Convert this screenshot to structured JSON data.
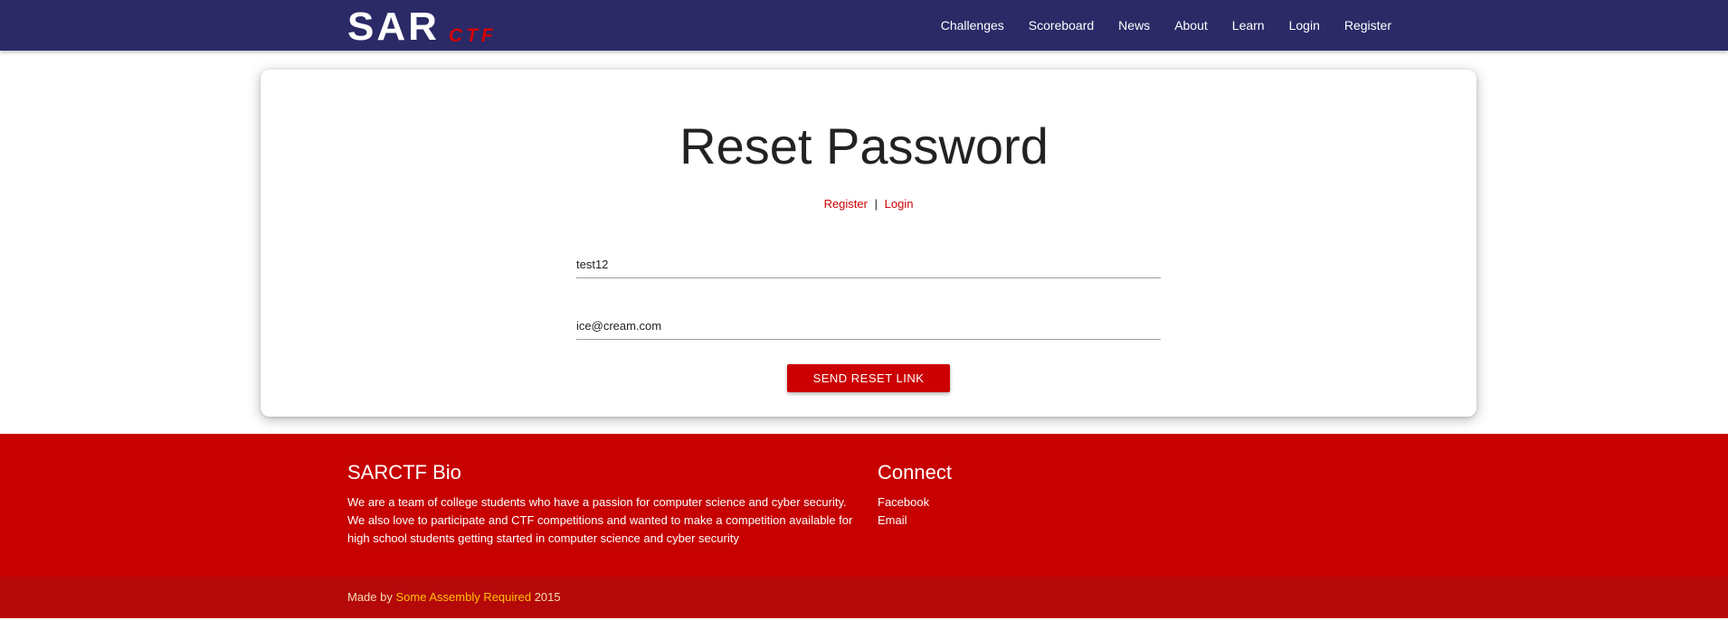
{
  "brand": {
    "logo_main": "SAR",
    "logo_sub": "CTF"
  },
  "nav": {
    "items": [
      {
        "label": "Challenges"
      },
      {
        "label": "Scoreboard"
      },
      {
        "label": "News"
      },
      {
        "label": "About"
      },
      {
        "label": "Learn"
      },
      {
        "label": "Login"
      },
      {
        "label": "Register"
      }
    ]
  },
  "form": {
    "title": "Reset Password",
    "register_link": "Register",
    "separator": "|",
    "login_link": "Login",
    "username_value": "test12",
    "email_value": "ice@cream.com",
    "submit_label": "SEND RESET LINK"
  },
  "footer": {
    "bio_title": "SARCTF Bio",
    "bio_text": "We are a team of college students who have a passion for computer science and cyber security. We also love to participate and CTF competitions and wanted to make a competition available for high school students getting started in computer science and cyber security",
    "connect_title": "Connect",
    "connect_links": [
      "Facebook",
      "Email"
    ],
    "made_by_prefix": "Made by",
    "made_by_link": "Some Assembly Required",
    "made_by_year": "2015"
  },
  "colors": {
    "navbar": "#2b2a67",
    "accent_red": "#cc0000",
    "footer": "#c70000",
    "footer_bottom": "#b50808",
    "copyright_link": "#ffc107"
  }
}
